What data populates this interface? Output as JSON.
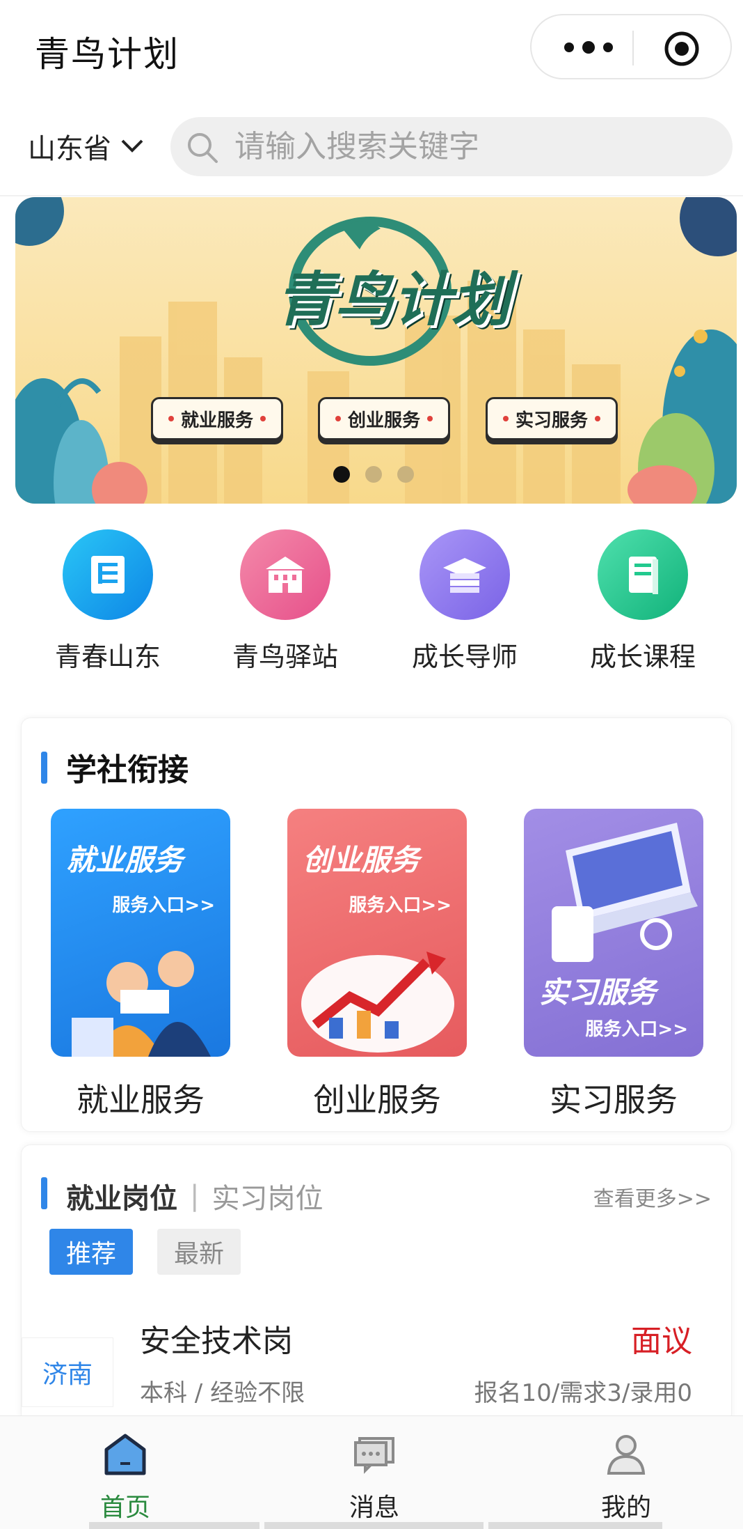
{
  "header": {
    "title": "青鸟计划"
  },
  "location": {
    "province": "山东省"
  },
  "search": {
    "placeholder": "请输入搜索关键字"
  },
  "banner": {
    "logo_text": "青鸟计划",
    "pills": [
      "就业服务",
      "创业服务",
      "实习服务"
    ],
    "page_count": 3,
    "active_page": 1
  },
  "quick_nav": [
    {
      "label": "青春山东",
      "icon": "document-icon",
      "color": "#1aa3ef"
    },
    {
      "label": "青鸟驿站",
      "icon": "building-icon",
      "color": "#ef6f99"
    },
    {
      "label": "成长导师",
      "icon": "graduation-cap-icon",
      "color": "#8b7bf0"
    },
    {
      "label": "成长课程",
      "icon": "book-icon",
      "color": "#22c98e"
    }
  ],
  "school_society": {
    "title": "学社衔接",
    "services": [
      {
        "label": "就业服务",
        "image_title": "就业服务",
        "image_sub": "服务入口>>",
        "color": "#2b8ef0"
      },
      {
        "label": "创业服务",
        "image_title": "创业服务",
        "image_sub": "服务入口>>",
        "color": "#ef6c6a"
      },
      {
        "label": "实习服务",
        "image_title": "实习服务",
        "image_sub": "服务入口>>",
        "color": "#9783dd"
      }
    ]
  },
  "jobs": {
    "tab_active": "就业岗位",
    "tab_inactive": "实习岗位",
    "more": "查看更多>>",
    "chips": [
      "推荐",
      "最新"
    ],
    "item": {
      "city": "济南",
      "title": "安全技术岗",
      "salary": "面议",
      "requirements": "本科 / 经验不限",
      "stats": "报名10/需求3/录用0"
    }
  },
  "tabbar": {
    "items": [
      {
        "label": "首页",
        "active": true
      },
      {
        "label": "消息",
        "active": false
      },
      {
        "label": "我的",
        "active": false
      }
    ],
    "active_color": "#2a8a3e"
  }
}
